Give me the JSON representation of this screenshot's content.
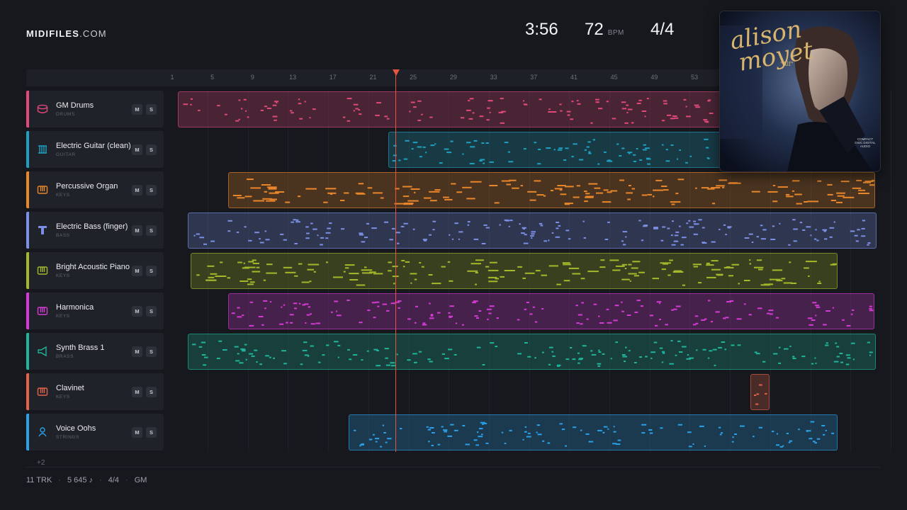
{
  "brand": {
    "part1": "MIDIFILES",
    "part2": ".COM"
  },
  "header": {
    "duration": "3:56",
    "tempo": "72",
    "tempo_unit": "BPM",
    "time_signature": "4/4"
  },
  "ruler": {
    "ticks": [
      "1",
      "5",
      "9",
      "13",
      "17",
      "21",
      "25",
      "29",
      "33",
      "37",
      "41",
      "45",
      "49",
      "53"
    ]
  },
  "playhead": {
    "bar": 23
  },
  "tracks": [
    {
      "name": "GM Drums",
      "category": "DRUMS",
      "icon": "drum-icon",
      "color": "#e0497a",
      "mute_label": "M",
      "solo_label": "S"
    },
    {
      "name": "Electric Guitar (clean)",
      "category": "GUITAR",
      "icon": "guitar-icon",
      "color": "#1f9fc0",
      "mute_label": "M",
      "solo_label": "S"
    },
    {
      "name": "Percussive Organ",
      "category": "KEYS",
      "icon": "keys-icon",
      "color": "#e9862a",
      "mute_label": "M",
      "solo_label": "S"
    },
    {
      "name": "Electric Bass (finger)",
      "category": "BASS",
      "icon": "bass-icon",
      "color": "#7b8fe6",
      "mute_label": "M",
      "solo_label": "S"
    },
    {
      "name": "Bright Acoustic Piano",
      "category": "KEYS",
      "icon": "keys-icon",
      "color": "#a4b82a",
      "mute_label": "M",
      "solo_label": "S"
    },
    {
      "name": "Harmonica",
      "category": "KEYS",
      "icon": "keys-icon",
      "color": "#d63ad6",
      "mute_label": "M",
      "solo_label": "S"
    },
    {
      "name": "Synth Brass 1",
      "category": "BRASS",
      "icon": "horn-icon",
      "color": "#1fb59a",
      "mute_label": "M",
      "solo_label": "S"
    },
    {
      "name": "Clavinet",
      "category": "KEYS",
      "icon": "keys-icon",
      "color": "#e3624a",
      "mute_label": "M",
      "solo_label": "S"
    },
    {
      "name": "Voice Oohs",
      "category": "STRINGS",
      "icon": "voice-icon",
      "color": "#2aa0e8",
      "mute_label": "M",
      "solo_label": "S"
    }
  ],
  "more_tracks": "+2",
  "footer": {
    "tracks": "11 TRK",
    "notes": "5 645 ♪",
    "signature": "4/4",
    "standard": "GM"
  },
  "album": {
    "title_line1": "alison",
    "title_line2": "moyet",
    "subtitle": "\"Alf\"",
    "badge": "COMPACT DISC DIGITAL AUDIO"
  }
}
